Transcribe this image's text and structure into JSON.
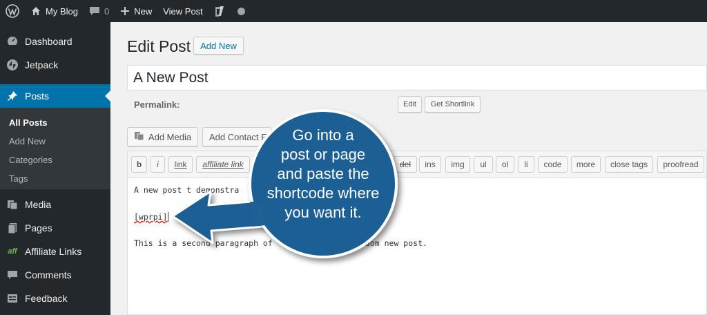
{
  "adminbar": {
    "site_name": "My Blog",
    "comments_count": "0",
    "new_label": "New",
    "view_post_label": "View Post"
  },
  "sidebar": {
    "items": [
      {
        "label": "Dashboard",
        "icon": "dashboard-icon"
      },
      {
        "label": "Jetpack",
        "icon": "jetpack-icon"
      },
      {
        "label": "Posts",
        "icon": "pushpin-icon"
      },
      {
        "label": "Media",
        "icon": "media-icon"
      },
      {
        "label": "Pages",
        "icon": "pages-icon"
      },
      {
        "label": "Affiliate Links",
        "icon": "aff-icon"
      },
      {
        "label": "Comments",
        "icon": "comments-icon"
      },
      {
        "label": "Feedback",
        "icon": "feedback-icon"
      }
    ],
    "submenu": [
      "All Posts",
      "Add New",
      "Categories",
      "Tags"
    ]
  },
  "page": {
    "title": "Edit Post",
    "add_new_label": "Add New",
    "post_title": "A New Post",
    "permalink_label": "Permalink:",
    "edit_label": "Edit",
    "shortlink_label": "Get Shortlink",
    "add_media_label": "Add Media",
    "add_contact_label": "Add Contact F"
  },
  "quicktags": [
    "b",
    "i",
    "link",
    "affiliate link",
    "del",
    "ins",
    "img",
    "ul",
    "ol",
    "li",
    "code",
    "more",
    "close tags",
    "proofread"
  ],
  "editor": {
    "line1": "A new post t demonstra",
    "line2": "[wprpi]",
    "line3": "This is a second paragraph of",
    "line3_tail": "ndom new post."
  },
  "callout": {
    "lines": [
      "Go into a",
      "post or page",
      "and paste the",
      "shortcode where",
      "you want it."
    ],
    "fill_color": "#1f5f94",
    "accent_color": "#0073aa"
  },
  "colors": {
    "adminbar_bg": "#23282d",
    "menu_current": "#0073aa",
    "page_bg": "#f1f1f1"
  }
}
